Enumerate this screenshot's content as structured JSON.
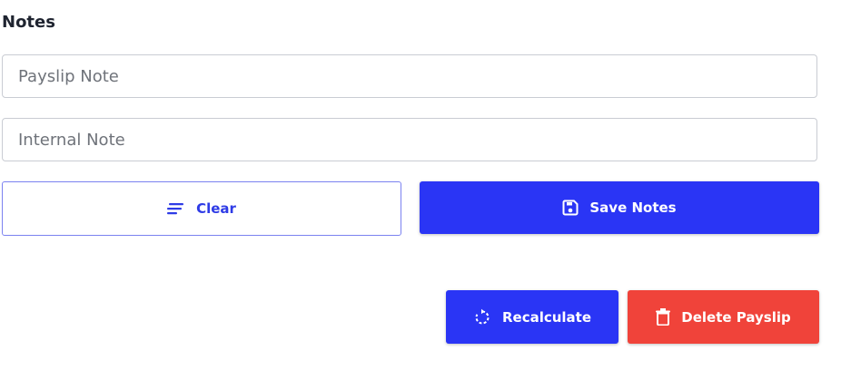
{
  "notes": {
    "title": "Notes",
    "payslip_note": {
      "value": "",
      "placeholder": "Payslip Note"
    },
    "internal_note": {
      "value": "",
      "placeholder": "Internal Note"
    }
  },
  "actions": {
    "clear_label": "Clear",
    "clear_icon": "lines-icon",
    "save_label": "Save Notes",
    "save_icon": "floppy-disk-icon",
    "recalculate_label": "Recalculate",
    "recalculate_icon": "refresh-icon",
    "delete_label": "Delete Payslip",
    "delete_icon": "trash-icon"
  },
  "colors": {
    "primary": "#2a35f5",
    "danger": "#f0433a",
    "outline_border": "#7b82f0",
    "text_dark": "#1f2430"
  }
}
